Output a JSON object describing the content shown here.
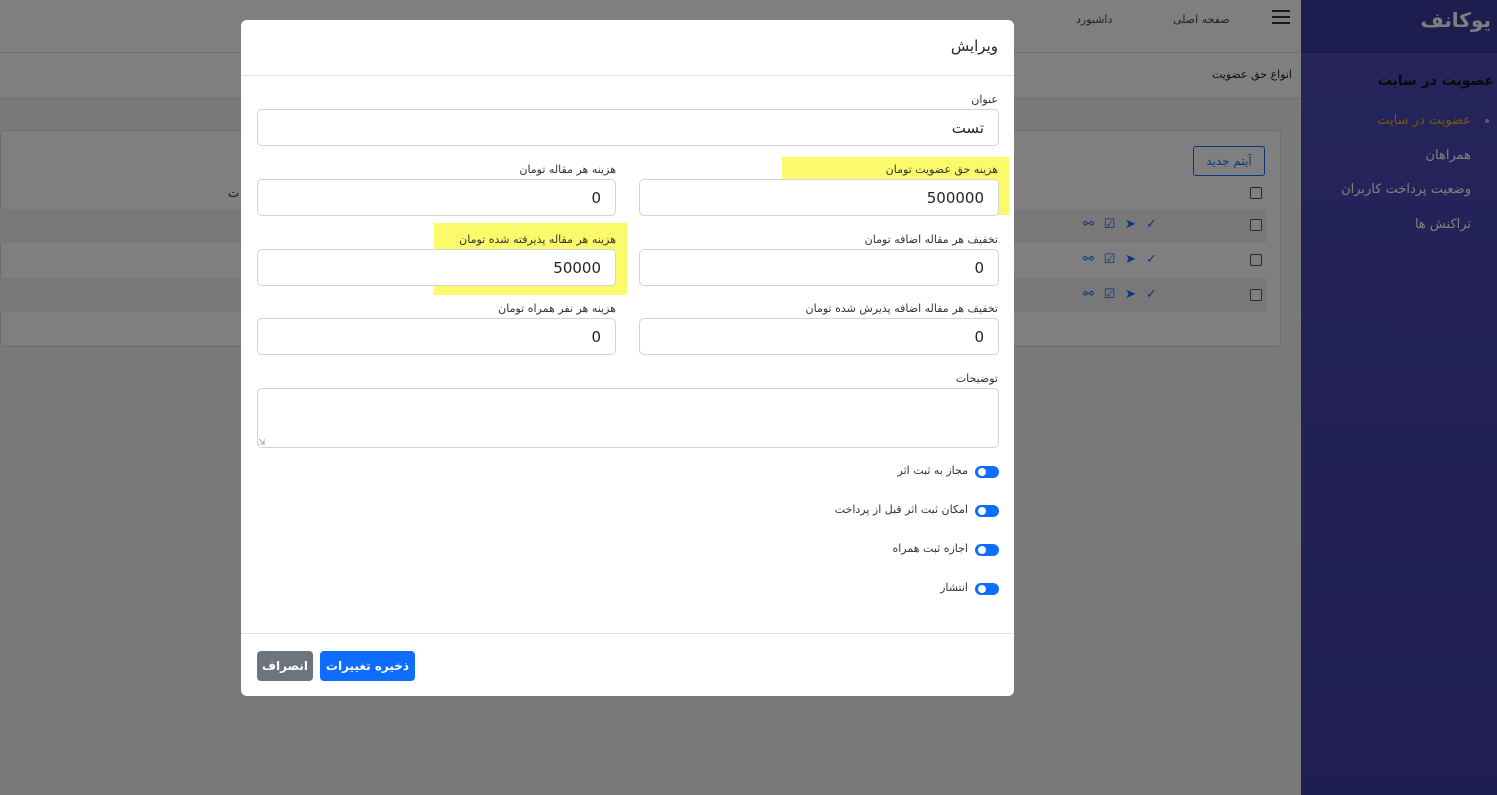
{
  "topbar": {
    "home_link": "صفحه اصلی",
    "dashboard_link": "داشبورد"
  },
  "breadcrumb": "انواع حق عضویت",
  "list": {
    "new_item_label": "آیتم جدید",
    "edge_text": "ت"
  },
  "sidebar": {
    "logo": "یوکانف",
    "heading": "عضویت در سایت",
    "items": [
      {
        "label": "عضویت در سایت",
        "active": true
      },
      {
        "label": "همراهان",
        "active": false
      },
      {
        "label": "وضعیت پرداخت کاربران",
        "active": false
      },
      {
        "label": "تراکنش ها",
        "active": false
      }
    ],
    "active_color": "#f4b400",
    "bg_color": "#4d4ab8"
  },
  "modal": {
    "title": "ویرایش",
    "fields": {
      "title": {
        "label": "عنوان",
        "value": "تست"
      },
      "membership_fee": {
        "label": "هزینه حق عضویت تومان",
        "value": "500000",
        "highlighted": true
      },
      "article_fee": {
        "label": "هزینه هر مقاله تومان",
        "value": "0"
      },
      "extra_article_discount": {
        "label": "تخفیف هر مقاله اضافه تومان",
        "value": "0"
      },
      "accepted_article_fee": {
        "label": "هزینه هر مقاله پذیرفته شده تومان",
        "value": "50000",
        "highlighted": true
      },
      "extra_accepted_discount": {
        "label": "تخفیف هر مقاله اضافه پذیرش شده تومان",
        "value": "0"
      },
      "companion_fee": {
        "label": "هزینه هر نفر همراه تومان",
        "value": "0"
      },
      "description": {
        "label": "توضیحات",
        "value": ""
      }
    },
    "toggles": [
      {
        "label": "مجاز به ثبت اثر",
        "on": true
      },
      {
        "label": "امکان ثبت اثر قبل از پرداخت",
        "on": true
      },
      {
        "label": "اجازه ثبت همراه",
        "on": true
      },
      {
        "label": "انتشار",
        "on": true
      }
    ],
    "save_label": "ذخیره تغییرات",
    "cancel_label": "انصراف",
    "highlight_color": "#fbfa6a",
    "primary_color": "#0d6efd"
  }
}
